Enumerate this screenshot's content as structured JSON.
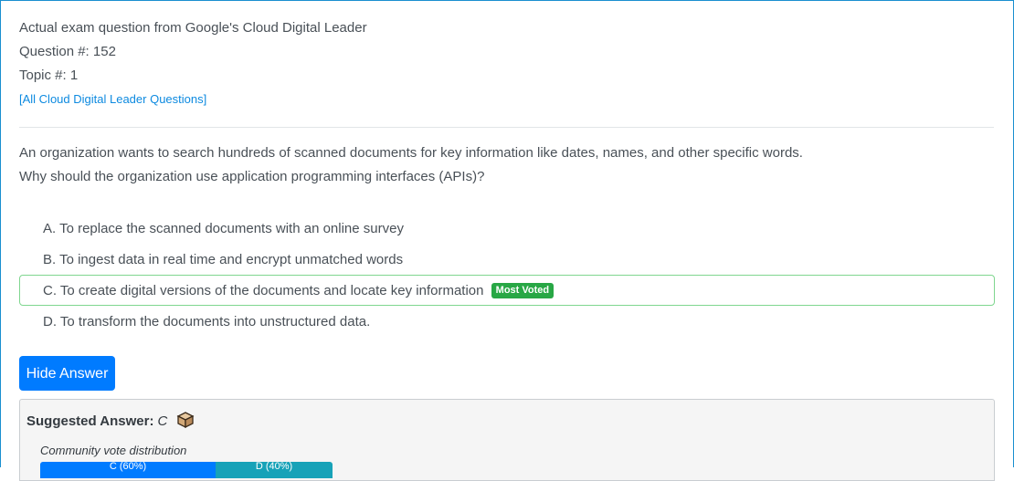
{
  "header": {
    "exam_line": "Actual exam question from Google's Cloud Digital Leader",
    "question_number": "Question #: 152",
    "topic": "Topic #: 1",
    "all_questions_link": "[All Cloud Digital Leader Questions]"
  },
  "question": {
    "line1": "An organization wants to search hundreds of scanned documents for key information like dates, names, and other specific words.",
    "line2": "Why should the organization use application programming interfaces (APIs)?"
  },
  "choices": [
    {
      "label": "A. To replace the scanned documents with an online survey"
    },
    {
      "label": "B. To ingest data in real time and encrypt unmatched words"
    },
    {
      "label": "C. To create digital versions of the documents and locate key information",
      "badge": "Most Voted"
    },
    {
      "label": "D. To transform the documents into unstructured data."
    }
  ],
  "hide_answer_button": "Hide Answer",
  "suggested": {
    "label": "Suggested Answer:",
    "letter": "C"
  },
  "votes": {
    "label": "Community vote distribution",
    "segments": [
      {
        "text": "C (60%)",
        "percent": 60
      },
      {
        "text": "D (40%)",
        "percent": 40
      }
    ]
  },
  "colors": {
    "accent": "#007bff",
    "badge": "#28a745",
    "segment_c": "#007bff",
    "segment_d": "#17a2b8"
  }
}
